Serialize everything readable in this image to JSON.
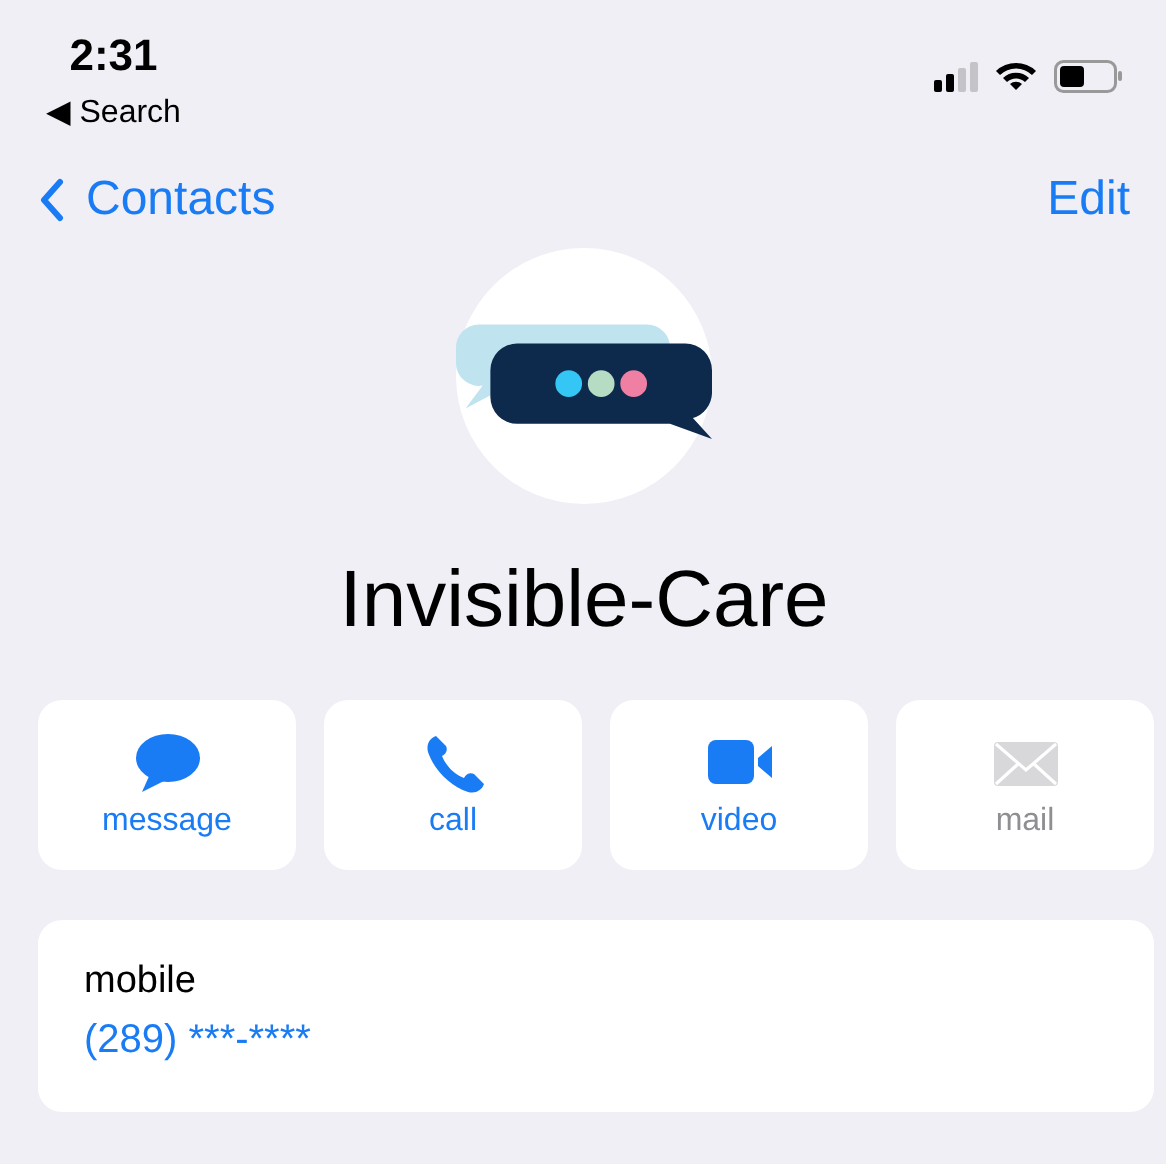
{
  "status_bar": {
    "time": "2:31",
    "back_label": "◀ Search"
  },
  "nav": {
    "back": "Contacts",
    "action": "Edit"
  },
  "contact": {
    "name": "Invisible-Care"
  },
  "actions": [
    {
      "kind": "message",
      "label": "message",
      "disabled": false
    },
    {
      "kind": "call",
      "label": "call",
      "disabled": false
    },
    {
      "kind": "video",
      "label": "video",
      "disabled": false
    },
    {
      "kind": "mail",
      "label": "mail",
      "disabled": true
    }
  ],
  "phone": {
    "label": "mobile",
    "number": "(289) ***-****"
  }
}
